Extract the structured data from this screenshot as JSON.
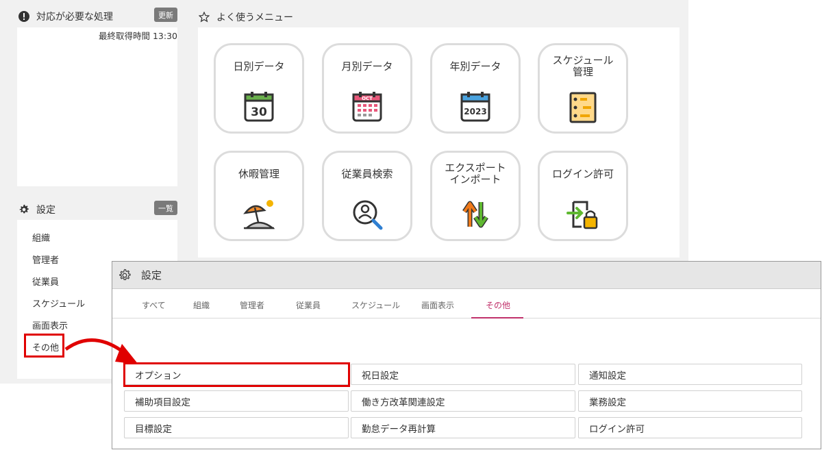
{
  "alerts": {
    "title": "対応が必要な処理",
    "update_button": "更新",
    "last_fetched": "最終取得時間 13:30"
  },
  "settings_panel": {
    "title": "設定",
    "list_button": "一覧",
    "items": [
      "組織",
      "管理者",
      "従業員",
      "スケジュール",
      "画面表示",
      "その他"
    ]
  },
  "favorites": {
    "title": "よく使うメニュー",
    "tiles": [
      {
        "label": "日別データ",
        "icon": "calendar-30-icon"
      },
      {
        "label": "月別データ",
        "icon": "calendar-oct-icon"
      },
      {
        "label": "年別データ",
        "icon": "calendar-2023-icon"
      },
      {
        "label": "スケジュール\n管理",
        "icon": "schedule-board-icon"
      },
      {
        "label": "休暇管理",
        "icon": "beach-umbrella-icon"
      },
      {
        "label": "従業員検索",
        "icon": "user-search-icon"
      },
      {
        "label": "エクスポート\nインポート",
        "icon": "up-down-arrows-icon"
      },
      {
        "label": "ログイン許可",
        "icon": "login-lock-icon"
      }
    ],
    "icon_texts": {
      "cal30": "30",
      "oct": "OCT",
      "year": "2023"
    }
  },
  "dialog": {
    "title": "設定",
    "tabs": [
      "すべて",
      "組織",
      "管理者",
      "従業員",
      "スケジュール",
      "画面表示",
      "その他"
    ],
    "active_tab": "その他",
    "options": [
      "オプション",
      "祝日設定",
      "通知設定",
      "補助項目設定",
      "働き方改革関連設定",
      "業務設定",
      "目標設定",
      "勤怠データ再計算",
      "ログイン許可"
    ]
  },
  "colors": {
    "highlight": "#e00000",
    "active_tab": "#c0306a",
    "badge": "#7a7a7a"
  }
}
